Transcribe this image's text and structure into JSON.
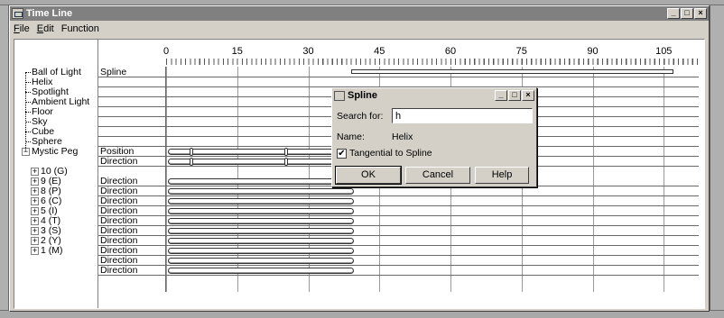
{
  "window": {
    "title": "Time Line",
    "controls": [
      "_",
      "□",
      "×"
    ]
  },
  "menu": [
    {
      "label": "File",
      "accel": "F",
      "rest": "ile"
    },
    {
      "label": "Edit",
      "accel": "E",
      "rest": "dit"
    },
    {
      "label": "Function",
      "accel": "",
      "rest": "Function"
    }
  ],
  "ruler": {
    "ticks": [
      "0",
      "15",
      "30",
      "45",
      "60",
      "75",
      "90",
      "105"
    ]
  },
  "tree": [
    {
      "label": "Ball of Light",
      "type": "leaf"
    },
    {
      "label": "Helix",
      "type": "leaf"
    },
    {
      "label": "Spotlight",
      "type": "leaf"
    },
    {
      "label": "Ambient Light",
      "type": "leaf"
    },
    {
      "label": "Floor",
      "type": "leaf"
    },
    {
      "label": "Sky",
      "type": "leaf"
    },
    {
      "label": "Cube",
      "type": "leaf"
    },
    {
      "label": "Sphere",
      "type": "leaf"
    },
    {
      "label": "Mystic Peg",
      "type": "expanded"
    },
    {
      "label": "10 (G)",
      "type": "collapsed"
    },
    {
      "label": "9 (E)",
      "type": "collapsed"
    },
    {
      "label": "8 (P)",
      "type": "collapsed"
    },
    {
      "label": "6 (C)",
      "type": "collapsed"
    },
    {
      "label": "5 (I)",
      "type": "collapsed"
    },
    {
      "label": "4 (T)",
      "type": "collapsed"
    },
    {
      "label": "3 (S)",
      "type": "collapsed"
    },
    {
      "label": "2 (Y)",
      "type": "collapsed"
    },
    {
      "label": "1 (M)",
      "type": "collapsed"
    }
  ],
  "tracks": [
    {
      "label": "Spline",
      "kind": "spline",
      "start": 39,
      "end": 107
    },
    {
      "label": "",
      "kind": "empty"
    },
    {
      "label": "",
      "kind": "empty"
    },
    {
      "label": "",
      "kind": "empty"
    },
    {
      "label": "",
      "kind": "empty"
    },
    {
      "label": "",
      "kind": "empty"
    },
    {
      "label": "",
      "kind": "empty"
    },
    {
      "label": "",
      "kind": "empty"
    },
    {
      "label": "Position",
      "kind": "bar",
      "start": 0,
      "end": 40,
      "handles": [
        5,
        25
      ]
    },
    {
      "label": "Direction",
      "kind": "bar",
      "start": 0,
      "end": 40,
      "handles": [
        5,
        25
      ]
    },
    {
      "label": "Direction",
      "kind": "bar",
      "start": 0,
      "end": 40
    },
    {
      "label": "Direction",
      "kind": "bar",
      "start": 0,
      "end": 40
    },
    {
      "label": "Direction",
      "kind": "bar",
      "start": 0,
      "end": 40
    },
    {
      "label": "Direction",
      "kind": "bar",
      "start": 0,
      "end": 40
    },
    {
      "label": "Direction",
      "kind": "bar",
      "start": 0,
      "end": 40
    },
    {
      "label": "Direction",
      "kind": "bar",
      "start": 0,
      "end": 40
    },
    {
      "label": "Direction",
      "kind": "bar",
      "start": 0,
      "end": 40
    },
    {
      "label": "Direction",
      "kind": "bar",
      "start": 0,
      "end": 40
    },
    {
      "label": "Direction",
      "kind": "bar",
      "start": 0,
      "end": 40
    },
    {
      "label": "Direction",
      "kind": "bar",
      "start": 0,
      "end": 40
    }
  ],
  "dialog": {
    "title": "Spline",
    "search_label": "Search for:",
    "search_value": "h",
    "name_label": "Name:",
    "name_value": "Helix",
    "checkbox_label": "Tangential to Spline",
    "checkbox_checked": true,
    "check_mark": "✔",
    "buttons": {
      "ok": "OK",
      "cancel": "Cancel",
      "help": "Help"
    },
    "controls": [
      "_",
      "□",
      "×"
    ]
  },
  "colors": {
    "titlebar_inactive": "#808080",
    "face": "#d4d0c8"
  }
}
